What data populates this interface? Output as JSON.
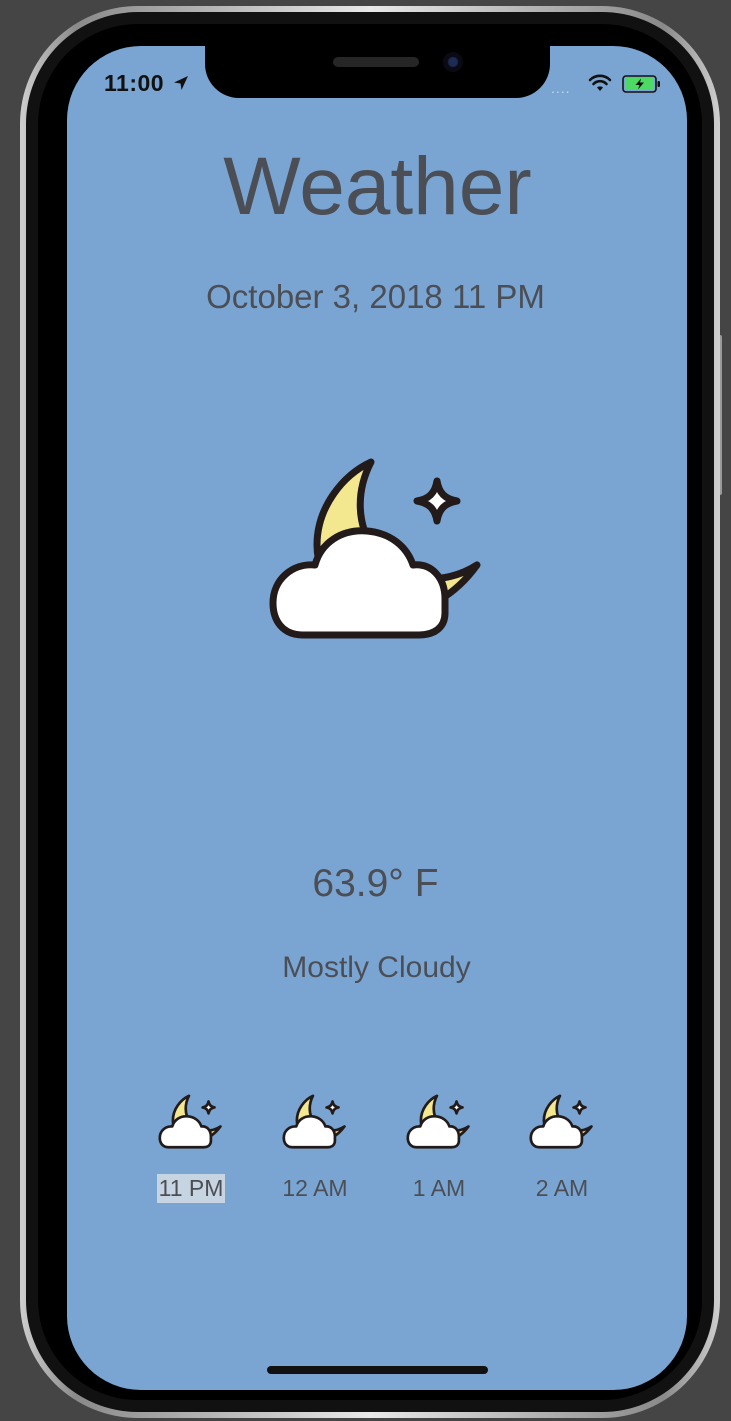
{
  "status_bar": {
    "time": "11:00",
    "signal_dots": "....",
    "location_icon": "location-arrow-icon",
    "wifi_icon": "wifi-icon",
    "battery_icon": "battery-charging-icon"
  },
  "app": {
    "title": "Weather",
    "date": "October 3, 2018 11 PM",
    "current_icon": "partly-cloudy-night-icon",
    "temperature": "63.9° F",
    "condition": "Mostly Cloudy"
  },
  "hourly": [
    {
      "label": "11 PM",
      "icon": "partly-cloudy-night-icon",
      "selected": true
    },
    {
      "label": "12 AM",
      "icon": "partly-cloudy-night-icon",
      "selected": false
    },
    {
      "label": "1 AM",
      "icon": "partly-cloudy-night-icon",
      "selected": false
    },
    {
      "label": "2 AM",
      "icon": "partly-cloudy-night-icon",
      "selected": false
    }
  ],
  "colors": {
    "screen_background": "#7aa5d3",
    "text": "#4b4f55",
    "moon": "#f3e88f",
    "cloud": "#ffffff",
    "outline": "#231a1a"
  }
}
